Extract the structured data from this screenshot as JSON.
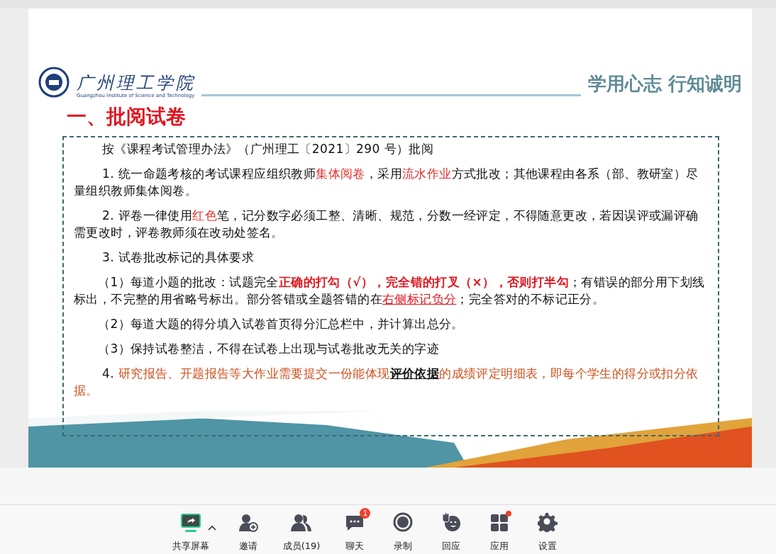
{
  "slide": {
    "school_name": "广州理工学院",
    "school_name_en": "Guangzhou Institute of Science and Technology",
    "motto": "学用心志 行知诚明",
    "title": "一、批阅试卷",
    "paragraphs": [
      {
        "kind": "lead",
        "segments": [
          {
            "kind": "plain",
            "text": "按《课程考试管理办法》（广州理工〔2021〕290 号）批阅"
          }
        ]
      },
      {
        "kind": "lead",
        "segments": [
          {
            "kind": "plain",
            "text": "1. 统一命题考核的考试课程应组织教师"
          },
          {
            "kind": "red",
            "text": "集体阅卷"
          },
          {
            "kind": "plain",
            "text": "，采用"
          },
          {
            "kind": "red",
            "text": "流水作业"
          },
          {
            "kind": "plain",
            "text": "方式批改；其他课程由各系（部、教研室）尽量组织教师集体阅卷。"
          }
        ]
      },
      {
        "kind": "lead",
        "segments": [
          {
            "kind": "plain",
            "text": "2. 评卷一律使用"
          },
          {
            "kind": "red",
            "text": "红色"
          },
          {
            "kind": "plain",
            "text": "笔，记分数字必须工整、清晰、规范，分数一经评定，不得随意更改，若因误评或漏评确需更改时，评卷教师须在改动处签名。"
          }
        ]
      },
      {
        "kind": "lead",
        "segments": [
          {
            "kind": "plain",
            "text": "3. 试卷批改标记的具体要求"
          }
        ]
      },
      {
        "kind": "sub",
        "segments": [
          {
            "kind": "plain",
            "text": "（1）每道小题的批改：试题完全"
          },
          {
            "kind": "red-bold",
            "text": "正确的打勾（√），完全错的打叉（×），否则打半勾"
          },
          {
            "kind": "plain",
            "text": "；有错误的部分用下划线标出，不完整的用省略号标出。部分答错或全题答错的在"
          },
          {
            "kind": "red-underline",
            "text": "右侧标记负分"
          },
          {
            "kind": "plain",
            "text": "；完全答对的不标记正分。"
          }
        ]
      },
      {
        "kind": "sub",
        "segments": [
          {
            "kind": "plain",
            "text": "（2）每道大题的得分填入试卷首页得分汇总栏中，并计算出总分。"
          }
        ]
      },
      {
        "kind": "sub",
        "segments": [
          {
            "kind": "plain",
            "text": "（3）保持试卷整洁，不得在试卷上出现与试卷批改无关的字迹"
          }
        ]
      },
      {
        "kind": "lead",
        "segments": [
          {
            "kind": "plain",
            "text": "4. "
          },
          {
            "kind": "orange",
            "text": "研究报告、开题报告等大作业需要提交一份能体现"
          },
          {
            "kind": "bold-underline",
            "text": "评价依据"
          },
          {
            "kind": "orange",
            "text": "的成绩评定明细表，即每个学生的得分或扣分依据。"
          }
        ]
      }
    ]
  },
  "toolbar": [
    {
      "kind": "share",
      "label": "共享屏幕"
    },
    {
      "kind": "invite",
      "label": "邀请"
    },
    {
      "kind": "members",
      "label": "成员(19)"
    },
    {
      "kind": "chat",
      "label": "聊天",
      "badge": "1"
    },
    {
      "kind": "record",
      "label": "录制"
    },
    {
      "kind": "react",
      "label": "回应"
    },
    {
      "kind": "apps",
      "label": "应用",
      "dot": true
    },
    {
      "kind": "settings",
      "label": "设置"
    }
  ]
}
